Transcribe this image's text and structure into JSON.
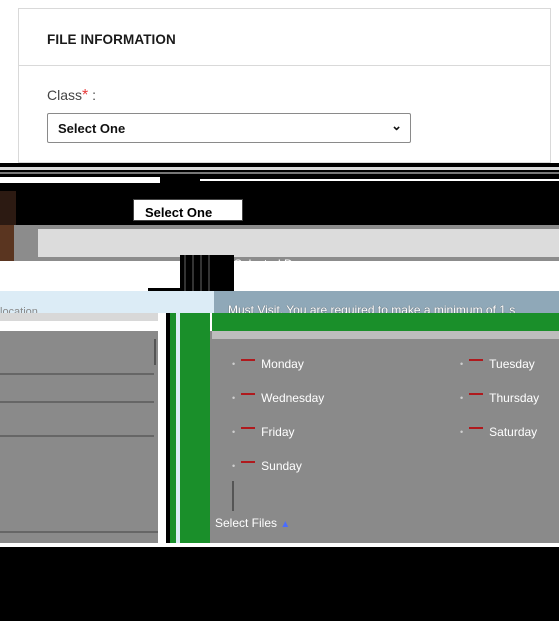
{
  "panel": {
    "title": "FILE INFORMATION",
    "class_label": "Class",
    "required_mark": "*",
    "class_suffix": " :",
    "class_select_value": "Select One"
  },
  "glitch": {
    "second_select_value": "Select One",
    "days_label": "Selected Days",
    "left_label": "location",
    "notice": "Must Visit. You are required to make a minimum of 1 s",
    "days": [
      {
        "label": "Monday"
      },
      {
        "label": "Tuesday"
      },
      {
        "label": "Wednesday"
      },
      {
        "label": "Thursday"
      },
      {
        "label": "Friday"
      },
      {
        "label": "Saturday"
      },
      {
        "label": "Sunday"
      }
    ],
    "select_files": "Select Files"
  },
  "colors": {
    "required": "#e83a3a",
    "green": "#1a8f2a",
    "gray": "#8a8a8a",
    "black": "#000000"
  },
  "icons": {
    "chevron": "chevron-down-icon",
    "checkbox": "checkbox-icon",
    "upload": "upload-icon"
  }
}
